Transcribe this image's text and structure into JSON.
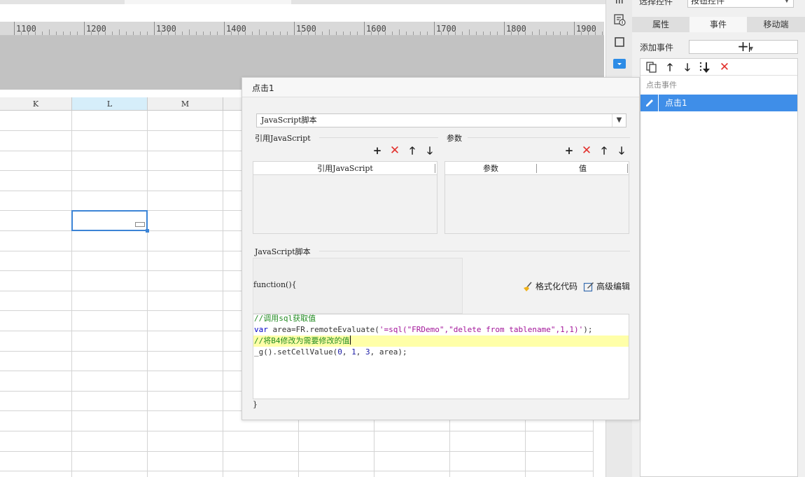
{
  "ruler": {
    "ticks": [
      "1100",
      "1200",
      "1300",
      "1400",
      "1500",
      "1600",
      "1700",
      "1800",
      "1900"
    ]
  },
  "sheet": {
    "columns": [
      "K",
      "L",
      "M"
    ],
    "selected_column": "L"
  },
  "right_panel": {
    "select_label": "选择控件",
    "select_value": "按钮控件",
    "tabs": [
      "属性",
      "事件",
      "移动端"
    ],
    "active_tab": "事件",
    "add_event_label": "添加事件",
    "event_list_header": "点击事件",
    "events": [
      "点击1"
    ]
  },
  "dialog": {
    "title": "点击1",
    "type_value": "JavaScript脚本",
    "ref_js_label": "引用JavaScript",
    "params_label": "参数",
    "ref_table_header": "引用JavaScript",
    "params_table_headers": [
      "参数",
      "值"
    ],
    "script_label": "JavaScript脚本",
    "function_header": "function(){",
    "format_code_label": "格式化代码",
    "advanced_edit_label": "高级编辑",
    "closing_brace": "}"
  },
  "code": {
    "line1": "//调用sql获取值",
    "line2_kw": "var",
    "line2_a": " area=FR.remoteEvaluate(",
    "line2_str": "'=sql(\"FRDemo\",\"delete from tablename\",1,1)'",
    "line2_b": ");",
    "line3": "//将B4修改为需要修改的值",
    "line4_a": "_g().setCellValue(",
    "line4_n1": "0",
    "line4_c1": ", ",
    "line4_n2": "1",
    "line4_c2": ", ",
    "line4_n3": "3",
    "line4_b": ", area);"
  },
  "colors": {
    "accent": "#3f8ee8",
    "delete_red": "#e2312d",
    "highlight_line": "#ffffa8",
    "comment": "#228b22",
    "keyword": "#0000c8",
    "string": "#a3159a"
  }
}
